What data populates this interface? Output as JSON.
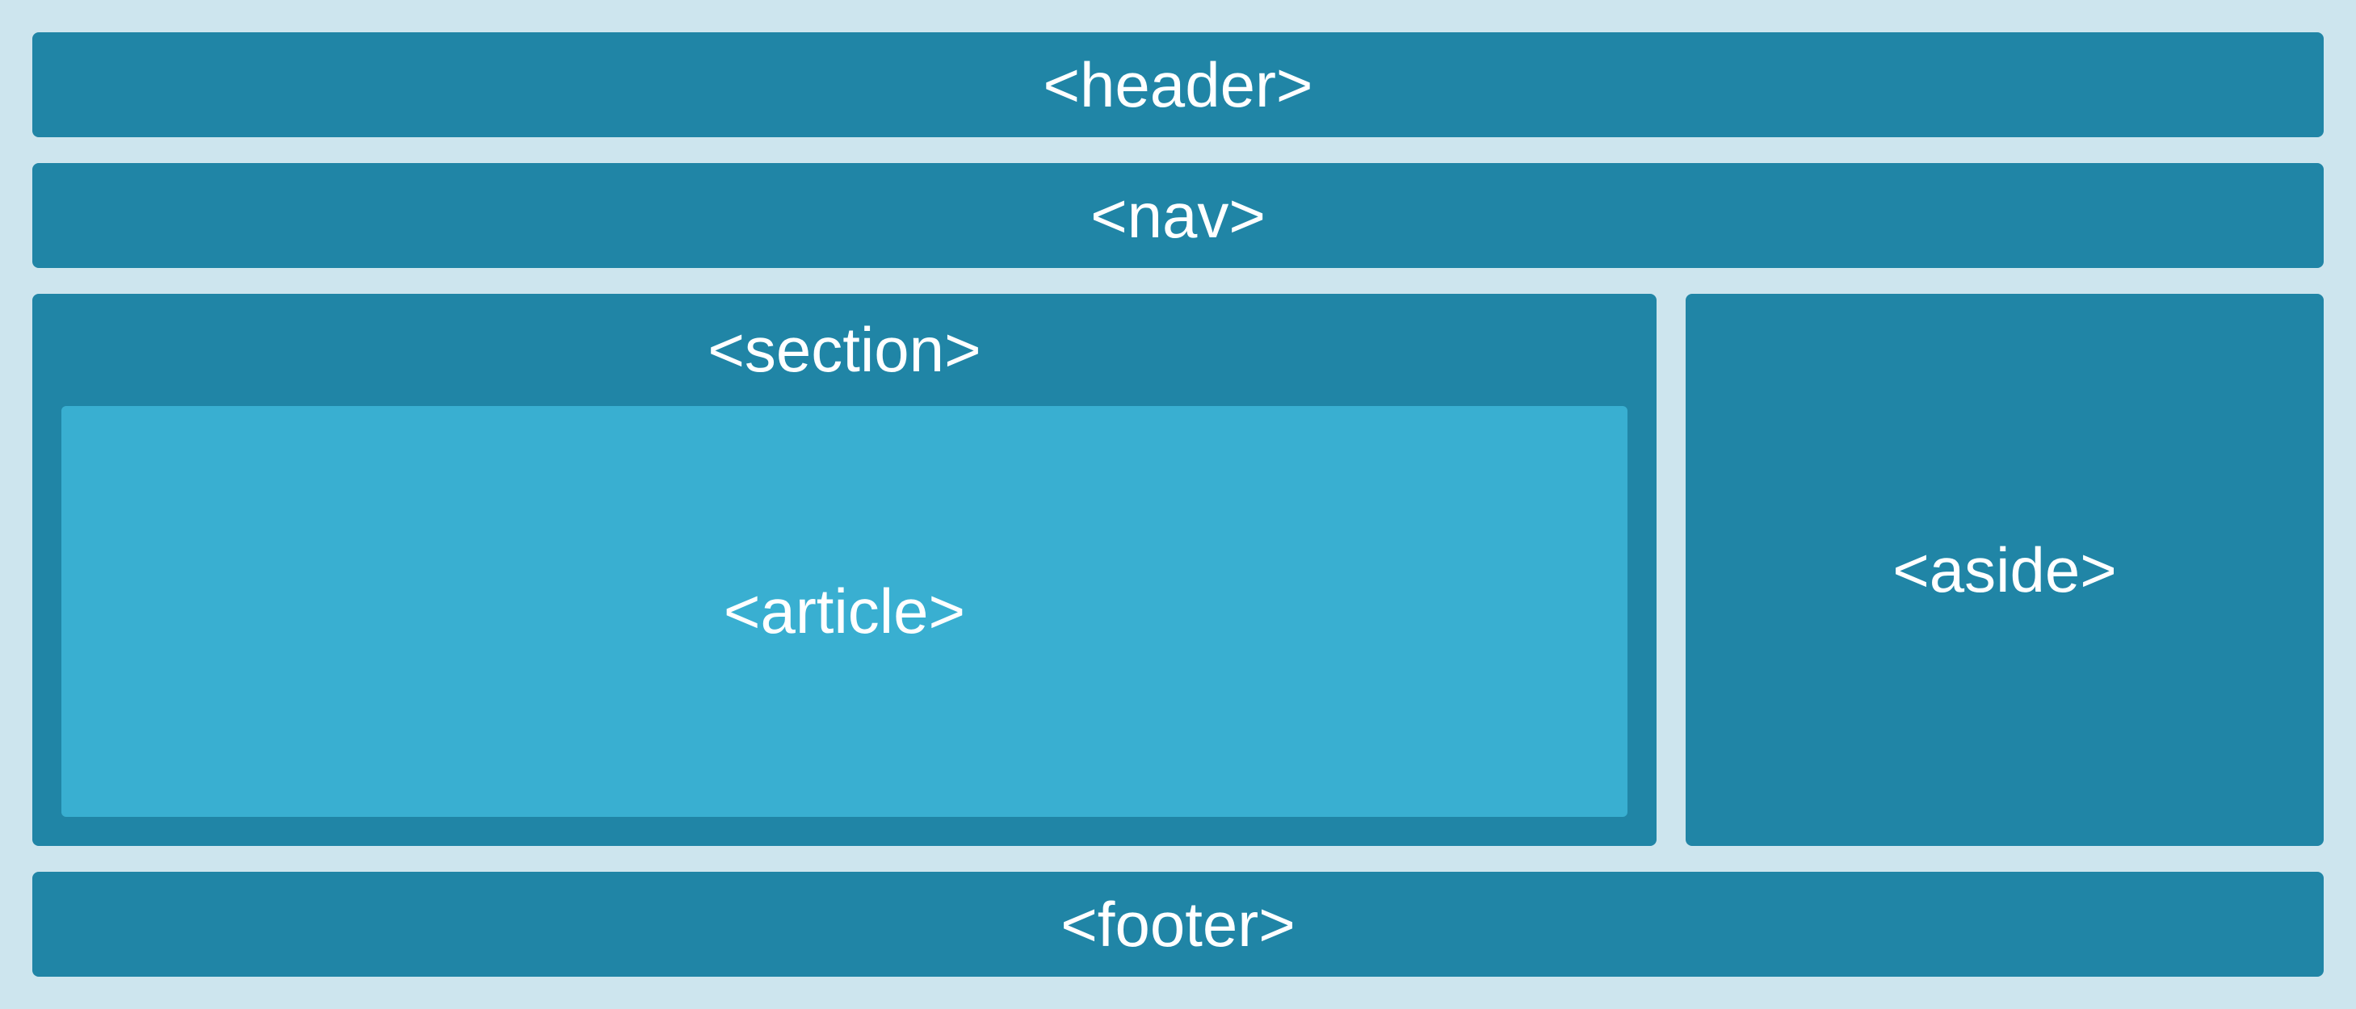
{
  "layout": {
    "header": "<header>",
    "nav": "<nav>",
    "section": "<section>",
    "article": "<article>",
    "aside": "<aside>",
    "footer": "<footer>"
  },
  "colors": {
    "background": "#cde5ee",
    "block": "#2085a6",
    "article": "#39afd1",
    "text": "#ffffff"
  }
}
